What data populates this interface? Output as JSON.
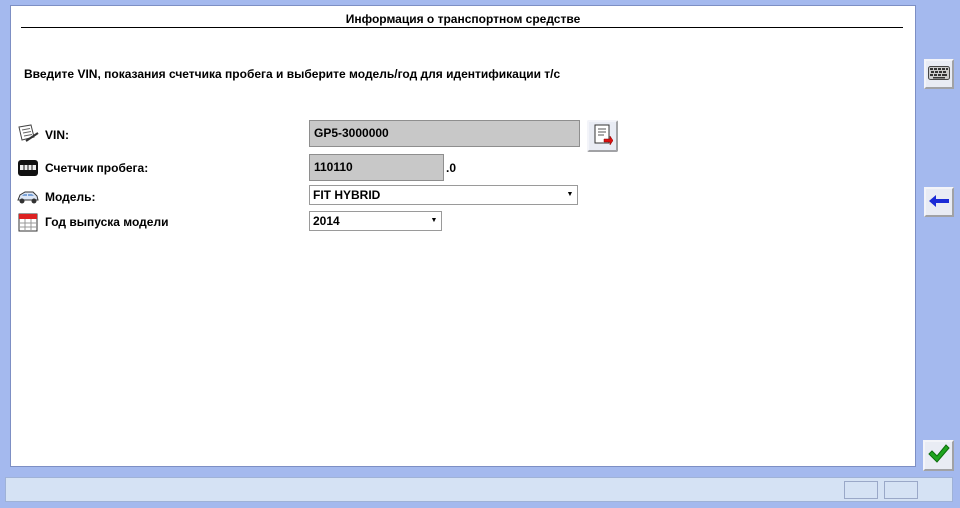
{
  "panel": {
    "title": "Информация о транспортном средстве",
    "instruction": "Введите VIN, показания счетчика пробега и выберите модель/год для идентификации т/с"
  },
  "form": {
    "vin": {
      "label": "VIN:",
      "value": "GP5-3000000",
      "icon": "notepad-pen-icon"
    },
    "odometer": {
      "label": "Счетчик пробега:",
      "value": "110110",
      "decimal": ".0",
      "icon": "odometer-icon"
    },
    "model": {
      "label": "Модель:",
      "selected": "FIT HYBRID",
      "icon": "car-icon"
    },
    "year": {
      "label": "Год выпуска модели",
      "selected": "2014",
      "icon": "calendar-icon"
    }
  },
  "sidebar": {
    "keyboard_button_icon": "keyboard-icon",
    "back_button_icon": "back-arrow-icon",
    "confirm_button_icon": "checkmark-icon"
  },
  "colors": {
    "background": "#a4b9ee",
    "field_gray": "#c8c8c8",
    "confirm_green": "#1fa51f",
    "back_blue": "#1b2bd6"
  }
}
